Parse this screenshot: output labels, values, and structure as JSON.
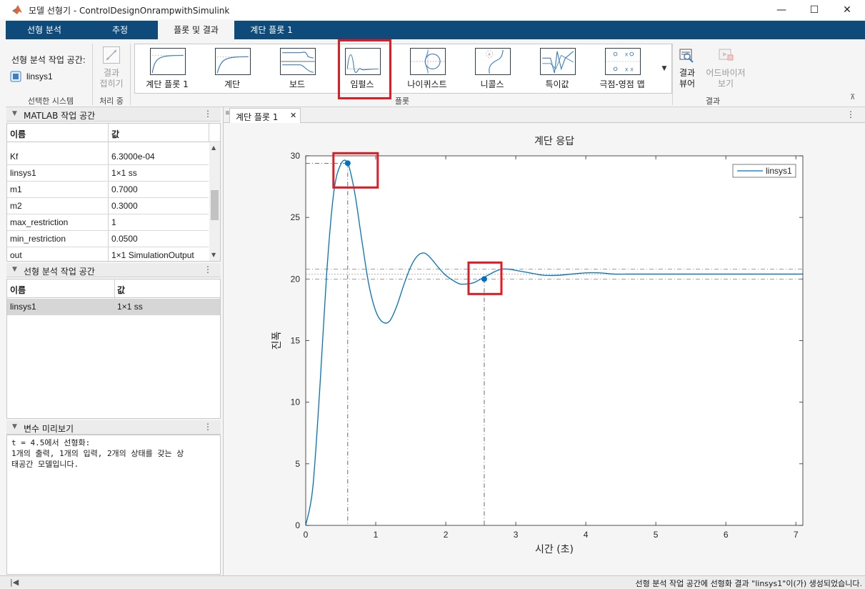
{
  "window": {
    "title": "모델 선형기 - ControlDesignOnrampwithSimulink",
    "minimize": "—",
    "maximize": "☐",
    "close": "✕"
  },
  "tabs": [
    {
      "label": "선형 분석"
    },
    {
      "label": "추정"
    },
    {
      "label": "플롯 및 결과"
    },
    {
      "label": "계단 플롯 1"
    }
  ],
  "ribbon": {
    "workspace_label": "선형 분석 작업 공간:",
    "selected_system": "linsys1",
    "section_selected": "선택한 시스템",
    "collapse_label": "결과\n접히기",
    "section_processing": "처리 중",
    "gallery": [
      {
        "label": "계단 플롯 1"
      },
      {
        "label": "계단"
      },
      {
        "label": "보드"
      },
      {
        "label": "임펄스"
      },
      {
        "label": "나이퀴스트"
      },
      {
        "label": "니콜스"
      },
      {
        "label": "특이값"
      },
      {
        "label": "극점-영점 맵"
      }
    ],
    "section_plots": "플롯",
    "result_viewer": "결과\n뷰어",
    "advisor": "어드바이저\n보기",
    "section_results": "결과"
  },
  "matlab_ws": {
    "title": "MATLAB 작업 공간",
    "col_name": "이름",
    "col_value": "값",
    "rows": [
      {
        "name": "Kf",
        "value": "6.3000e-04"
      },
      {
        "name": "linsys1",
        "value": "1×1 ss"
      },
      {
        "name": "m1",
        "value": "0.7000"
      },
      {
        "name": "m2",
        "value": "0.3000"
      },
      {
        "name": "max_restriction",
        "value": "1"
      },
      {
        "name": "min_restriction",
        "value": "0.0500"
      },
      {
        "name": "out",
        "value": "1×1 SimulationOutput"
      }
    ]
  },
  "lin_ws": {
    "title": "선형 분석 작업 공간",
    "col_name": "이름",
    "col_value": "값",
    "rows": [
      {
        "name": "linsys1",
        "value": "1×1 ss"
      }
    ]
  },
  "preview": {
    "title": "변수 미리보기",
    "line1": "t = 4.5에서 선형화:",
    "line2": "1개의 출력, 1개의 입력, 2개의 상태를 갖는 상",
    "line3": "태공간 모델입니다."
  },
  "doc_tab": {
    "label": "계단 플롯 1"
  },
  "chart_data": {
    "type": "line",
    "title": "계단 응답",
    "xlabel": "시간 (초)",
    "ylabel": "진폭",
    "xlim": [
      0,
      7.1
    ],
    "ylim": [
      0,
      30
    ],
    "xticks": [
      "0",
      "1",
      "2",
      "3",
      "4",
      "5",
      "6",
      "7"
    ],
    "yticks": [
      "0",
      "5",
      "10",
      "15",
      "20",
      "25",
      "30"
    ],
    "grid": false,
    "legend": "top-right",
    "series": [
      {
        "name": "linsys1",
        "color": "#0072bd",
        "x": [
          0,
          0.1,
          0.2,
          0.3,
          0.4,
          0.5,
          0.6,
          0.7,
          0.8,
          0.9,
          1.0,
          1.1,
          1.2,
          1.3,
          1.4,
          1.5,
          1.6,
          1.7,
          1.8,
          1.9,
          2.0,
          2.1,
          2.2,
          2.3,
          2.4,
          2.5,
          2.6,
          2.7,
          2.8,
          2.9,
          3.0,
          3.2,
          3.4,
          3.6,
          3.8,
          4.0,
          4.2,
          4.4,
          4.6,
          4.8,
          5.0,
          5.5,
          6.0,
          6.5,
          7.1
        ],
        "y": [
          0,
          3.0,
          11.0,
          20.5,
          27.0,
          29.3,
          29.4,
          27.0,
          23.2,
          19.6,
          17.4,
          16.5,
          16.6,
          17.8,
          19.5,
          21.0,
          21.9,
          22.1,
          21.6,
          20.9,
          20.3,
          19.9,
          19.6,
          19.6,
          19.7,
          20.0,
          20.3,
          20.6,
          20.8,
          20.8,
          20.7,
          20.5,
          20.3,
          20.3,
          20.4,
          20.5,
          20.5,
          20.4,
          20.4,
          20.4,
          20.4,
          20.4,
          20.4,
          20.4,
          20.4
        ]
      }
    ],
    "peak": {
      "x": 0.6,
      "y": 29.4
    },
    "settling": {
      "x": 2.55,
      "y": 20.0
    },
    "final_value": 20.4,
    "settling_band": [
      20.0,
      20.8
    ]
  },
  "status": {
    "text": "선형 분석 작업 공간에 선형화 결과 \"linsys1\"이(가) 생성되었습니다."
  }
}
